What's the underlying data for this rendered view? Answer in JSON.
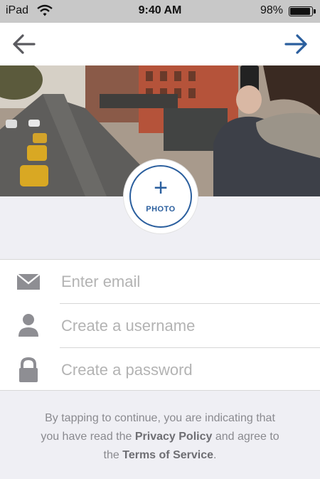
{
  "status_bar": {
    "carrier": "iPad",
    "time": "9:40 AM",
    "battery_percent": "98%",
    "battery_level": 0.98
  },
  "nav": {
    "back_icon": "arrow-left-icon",
    "next_icon": "arrow-right-icon",
    "accent_color": "#2b5f9e"
  },
  "photo_button": {
    "plus": "+",
    "label": "PHOTO"
  },
  "form": {
    "email_placeholder": "Enter email",
    "username_placeholder": "Create a username",
    "password_placeholder": "Create a password",
    "email_value": "",
    "username_value": "",
    "password_value": ""
  },
  "terms": {
    "line1": "By tapping to continue, you are indicating that",
    "line2_prefix": "you have read the ",
    "privacy_policy": "Privacy Policy",
    "line2_suffix": " and agree to",
    "line3_prefix": "the ",
    "terms_of_service": "Terms of Service",
    "line3_suffix": "."
  }
}
